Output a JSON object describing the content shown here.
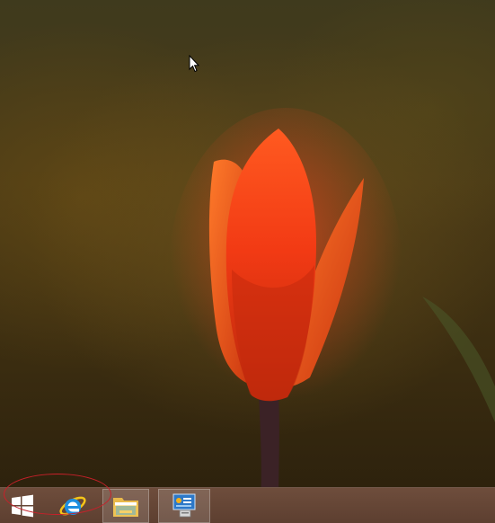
{
  "desktop": {
    "wallpaper": "orange-tulip-on-dark-background",
    "colors": {
      "tulip_bright": "#ff4a1a",
      "tulip_dark": "#c42a0c",
      "stem": "#3b2226",
      "background": "#3f3a1d"
    }
  },
  "taskbar": {
    "background_color": "#6e4d3c",
    "buttons": [
      {
        "name": "start",
        "icon": "windows-logo-icon",
        "active": false
      },
      {
        "name": "internet-explorer",
        "icon": "internet-explorer-icon",
        "active": false
      },
      {
        "name": "file-explorer",
        "icon": "folder-icon",
        "active": true
      },
      {
        "name": "server-manager",
        "icon": "server-manager-icon",
        "active": true
      }
    ]
  },
  "annotation": {
    "shape": "ellipse",
    "color": "#c8202a",
    "target": "start-and-internet-explorer-buttons"
  }
}
